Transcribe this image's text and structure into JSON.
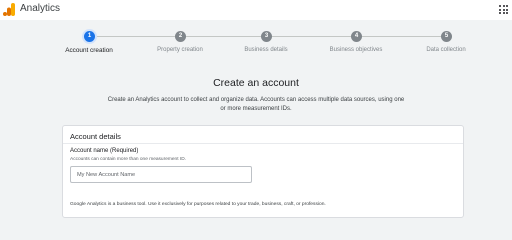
{
  "app": {
    "title": "Analytics",
    "logo_icon": "analytics-logo-icon",
    "apps_icon": "apps-grid-icon",
    "brand_colors": [
      "#f9ab00",
      "#e37400"
    ]
  },
  "stepper": {
    "active_color": "#1a73e8",
    "steps": [
      {
        "number": "1",
        "label": "Account creation",
        "active": true
      },
      {
        "number": "2",
        "label": "Property creation",
        "active": false
      },
      {
        "number": "3",
        "label": "Business details",
        "active": false
      },
      {
        "number": "4",
        "label": "Business objectives",
        "active": false
      },
      {
        "number": "5",
        "label": "Data collection",
        "active": false
      }
    ]
  },
  "main": {
    "heading": "Create an account",
    "description": "Create an Analytics account to collect and organize data. Accounts can access multiple data sources, using one or more measurement IDs."
  },
  "account_details": {
    "title": "Account details",
    "name_label": "Account name (Required)",
    "name_hint": "Accounts can contain more than one measurement ID.",
    "name_placeholder": "My New Account Name",
    "name_value": "",
    "footnote": "Google Analytics is a business tool. Use it exclusively for purposes related to your trade, business, craft, or profession."
  }
}
